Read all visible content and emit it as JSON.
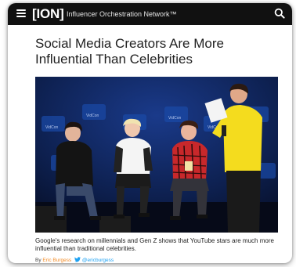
{
  "header": {
    "brand": "[ION]",
    "tagline": "Influencer Orchestration Network™"
  },
  "article": {
    "title": "Social Media Creators Are More Influential Than Celebrities",
    "summary": "Google's research on millennials and Gen Z shows that YouTube stars are much more influential than traditional celebrities.",
    "byline": {
      "prefix": "By",
      "author": "Eric Burgess",
      "handle": "@ericburgess"
    }
  },
  "photo": {
    "backdrop_text": "VidCon",
    "colors": {
      "backdrop": "#0d1f4d",
      "stage": "#0a0f1f"
    }
  },
  "colors": {
    "bar": "#111111",
    "author": "#f28c28",
    "twitter": "#1da1f2"
  }
}
